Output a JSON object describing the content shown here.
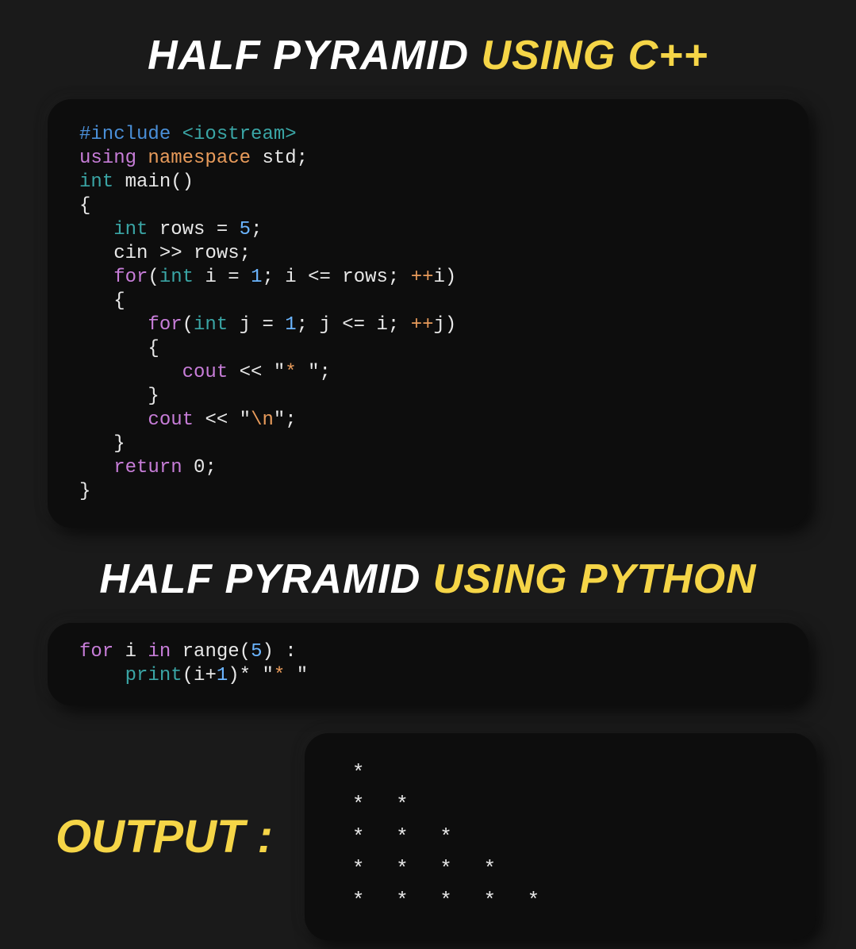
{
  "title1": {
    "part1": "HALF PYRAMID ",
    "part2": "USING C++"
  },
  "title2": {
    "part1": "HALF PYRAMID ",
    "part2": "USING PYTHON"
  },
  "output_label": "OUTPUT :",
  "cpp": {
    "l1a": "#include ",
    "l1b": "<iostream>",
    "l2a": "using ",
    "l2b": "namespace ",
    "l2c": "std;",
    "l3a": "int ",
    "l3b": "main",
    "l3c": "()",
    "l4": "{",
    "l5a": "   int ",
    "l5b": "rows ",
    "l5c": "= ",
    "l5d": "5",
    "l5e": ";",
    "l6a": "   cin ",
    "l6b": ">> ",
    "l6c": "rows;",
    "l7a": "   for",
    "l7b": "(",
    "l7c": "int ",
    "l7d": "i ",
    "l7e": "= ",
    "l7f": "1",
    "l7g": "; i <= rows; ",
    "l7h": "++",
    "l7i": "i)",
    "l8": "   {",
    "l9a": "      for",
    "l9b": "(",
    "l9c": "int ",
    "l9d": "j ",
    "l9e": "= ",
    "l9f": "1",
    "l9g": "; j <= i; ",
    "l9h": "++",
    "l9i": "j)",
    "l10": "      {",
    "l11a": "         cout ",
    "l11b": "<< ",
    "l11c": "\"",
    "l11d": "* ",
    "l11e": "\";",
    "l12": "      }",
    "l13a": "      cout ",
    "l13b": "<< ",
    "l13c": "\"",
    "l13d": "\\n",
    "l13e": "\";",
    "l14": "   }",
    "l15a": "   return ",
    "l15b": "0",
    "l15c": ";",
    "l16": "}"
  },
  "py": {
    "l1a": "for ",
    "l1b": "i ",
    "l1c": "in ",
    "l1d": "range",
    "l1e": "(",
    "l1f": "5",
    "l1g": ") :",
    "l2a": "    print",
    "l2b": "(i",
    "l2c": "+",
    "l2d": "1",
    "l2e": ")",
    "l2f": "* ",
    "l2g": "\"",
    "l2h": "* ",
    "l2i": "\""
  },
  "output": {
    "r1": "*",
    "r2": "* *",
    "r3": "* * *",
    "r4": "* * * *",
    "r5": "* * * * *"
  }
}
